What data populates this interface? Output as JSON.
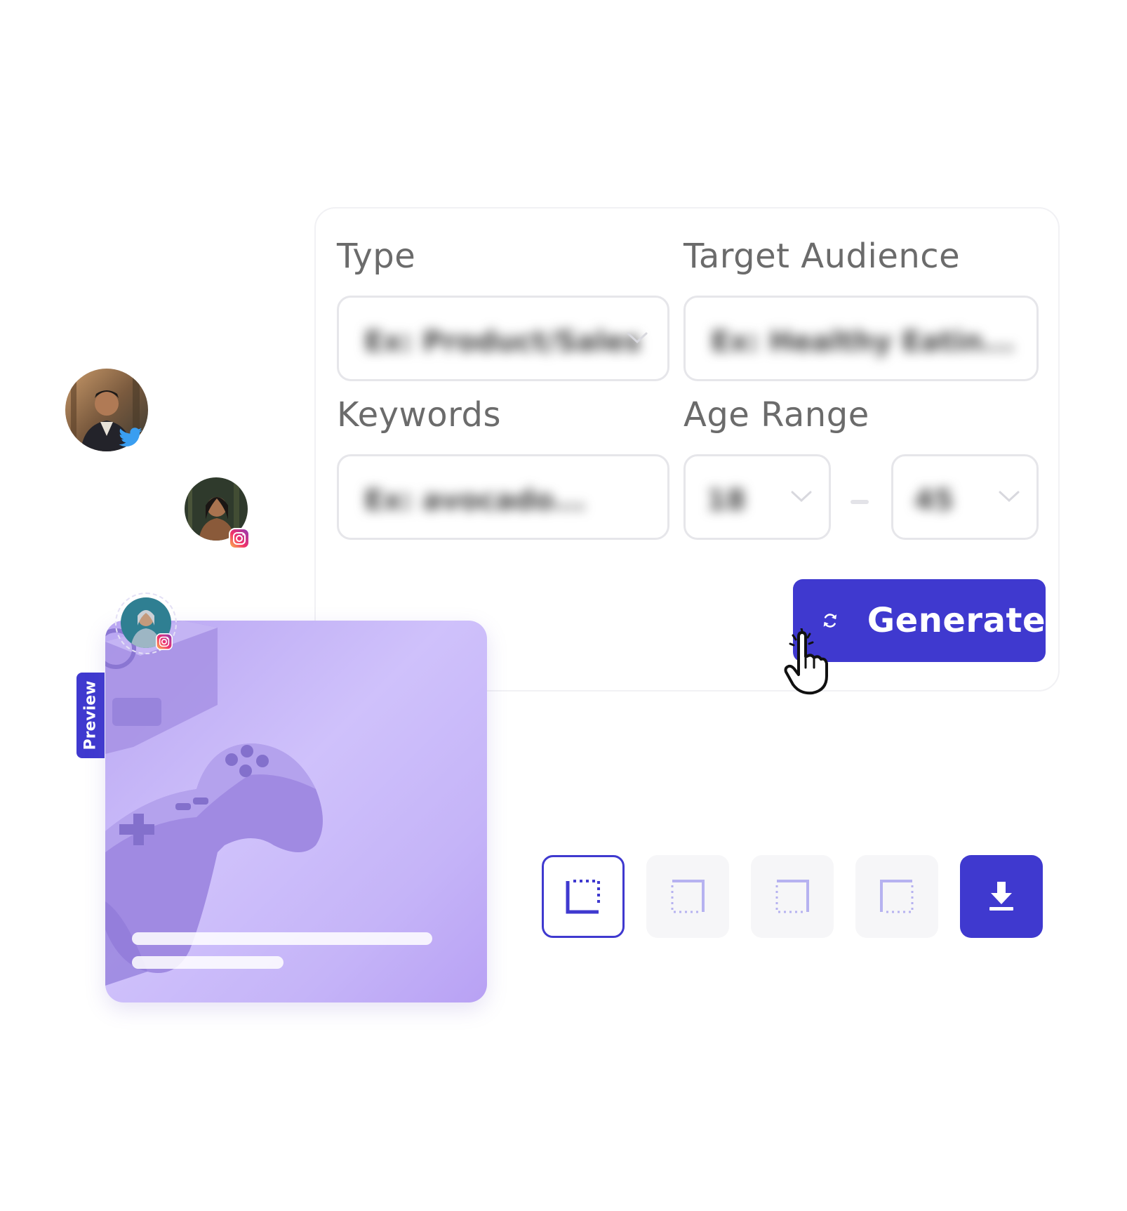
{
  "form": {
    "type_label": "Type",
    "type_placeholder": "Ex: Product/Sales",
    "audience_label": "Target Audience",
    "audience_placeholder": "Ex: Healthy Eatin...",
    "keywords_label": "Keywords",
    "keywords_placeholder": "Ex: avocado...",
    "age_label": "Age Range",
    "age_min": "18",
    "age_max": "45",
    "generate_label": "Generate"
  },
  "preview": {
    "tab_label": "Preview"
  },
  "colors": {
    "accent": "#3f39cf",
    "field_border": "#e6e6ea",
    "label": "#6b6b6b"
  },
  "icons": {
    "generate": "refresh-icon",
    "cursor": "hand-pointer-icon",
    "download": "download-icon",
    "twitter": "twitter-icon",
    "instagram": "instagram-icon"
  }
}
